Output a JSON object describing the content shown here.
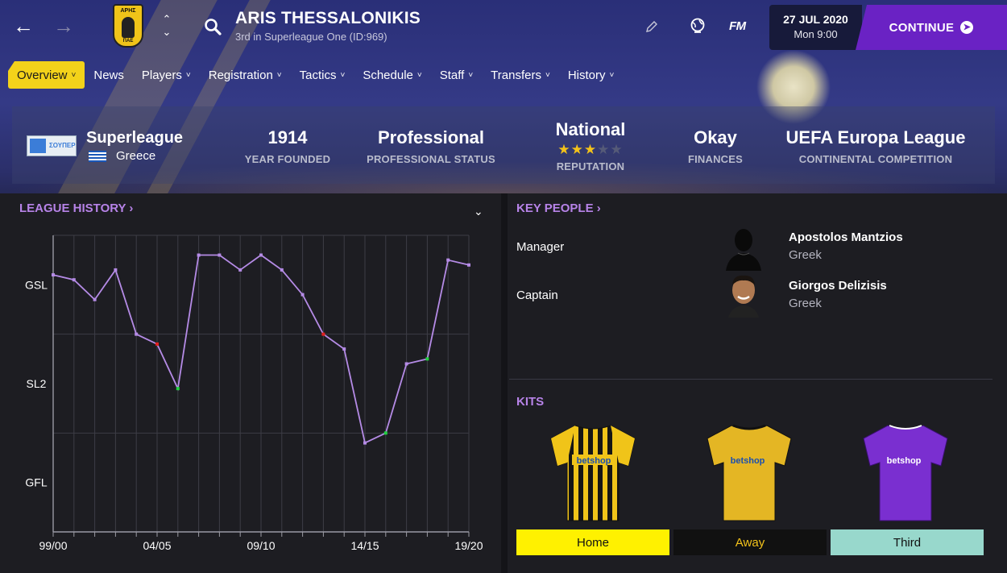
{
  "header": {
    "club_name": "ARIS THESSALONIKIS",
    "club_subtitle": "3rd in Superleague One (ID:969)",
    "crest_top_text": "ΑΡΗΣ",
    "crest_bottom_text": "ΠΑΕ",
    "fm_logo": "FM",
    "date": "27 JUL 2020",
    "time": "Mon 9:00",
    "continue_label": "CONTINUE"
  },
  "menu": [
    {
      "label": "Overview",
      "active": true
    },
    {
      "label": "News",
      "active": false,
      "no_caret": true
    },
    {
      "label": "Players",
      "active": false
    },
    {
      "label": "Registration",
      "active": false
    },
    {
      "label": "Tactics",
      "active": false
    },
    {
      "label": "Schedule",
      "active": false
    },
    {
      "label": "Staff",
      "active": false
    },
    {
      "label": "Transfers",
      "active": false
    },
    {
      "label": "History",
      "active": false
    }
  ],
  "info": {
    "league_name": "Superleague",
    "league_country": "Greece",
    "league_logo_text": "ΣΟΥΠΕΡ",
    "stats": [
      {
        "value": "1914",
        "label": "YEAR FOUNDED"
      },
      {
        "value": "Professional",
        "label": "PROFESSIONAL STATUS"
      },
      {
        "value": "National",
        "label": "REPUTATION",
        "stars": 3,
        "stars_total": 5
      },
      {
        "value": "Okay",
        "label": "FINANCES"
      },
      {
        "value": "UEFA Europa League",
        "label": "CONTINENTAL COMPETITION"
      }
    ]
  },
  "league_history": {
    "title": "LEAGUE HISTORY ›"
  },
  "chart_data": {
    "type": "line",
    "title": "",
    "x": [
      "99/00",
      "00/01",
      "01/02",
      "02/03",
      "03/04",
      "04/05",
      "05/06",
      "06/07",
      "07/08",
      "08/09",
      "09/10",
      "10/11",
      "11/12",
      "12/13",
      "13/14",
      "14/15",
      "15/16",
      "16/17",
      "17/18",
      "18/19",
      "19/20"
    ],
    "x_tick_labels": [
      "99/00",
      "04/05",
      "09/10",
      "14/15",
      "19/20"
    ],
    "y_tick_labels": [
      "GSL",
      "SL2",
      "GFL"
    ],
    "y_note": "league position rank (lower is better); tiers GSL, SL2, GFL",
    "y_values": [
      5,
      6,
      10,
      4,
      17,
      19,
      28,
      1,
      1,
      4,
      1,
      4,
      9,
      17,
      20,
      39,
      37,
      23,
      22,
      2,
      3
    ],
    "ylim": [
      -3,
      57
    ],
    "markers": [
      {
        "index": 5,
        "color": "#e02020"
      },
      {
        "index": 6,
        "color": "#20d040"
      },
      {
        "index": 13,
        "color": "#e02020"
      },
      {
        "index": 16,
        "color": "#20d040"
      },
      {
        "index": 18,
        "color": "#20d040"
      }
    ],
    "line_color": "#b58be6"
  },
  "key_people": {
    "title": "KEY PEOPLE ›",
    "people": [
      {
        "role": "Manager",
        "name": "Apostolos Mantzios",
        "nationality": "Greek"
      },
      {
        "role": "Captain",
        "name": "Giorgos Delizisis",
        "nationality": "Greek"
      }
    ]
  },
  "kits": {
    "title": "KITS",
    "sponsor": "betshop",
    "items": [
      {
        "label": "Home",
        "color": "#f0c419"
      },
      {
        "label": "Away",
        "color": "#e4b624"
      },
      {
        "label": "Third",
        "color": "#7a2fd0"
      }
    ]
  },
  "colors": {
    "accent_yellow": "#f3d21a",
    "accent_purple": "#6a22c4",
    "section_title": "#b783e8"
  }
}
